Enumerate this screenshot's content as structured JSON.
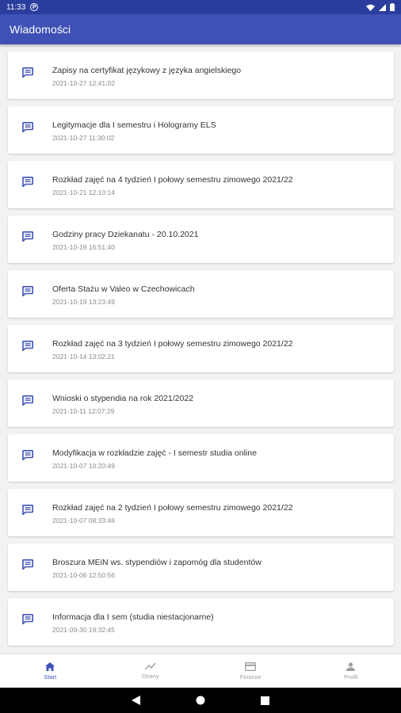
{
  "status_bar": {
    "time": "11:33"
  },
  "app_bar": {
    "title": "Wiadomości"
  },
  "messages": [
    {
      "title": "Zapisy na certyfikat językowy z języka angielskiego",
      "date": "2021-10-27 12:41:02"
    },
    {
      "title": "Legitymacje dla I semestru i Hologramy ELS",
      "date": "2021-10-27 11:30:02"
    },
    {
      "title": "Rozkład zajęć na 4 tydzień I połowy semestru zimowego 2021/22",
      "date": "2021-10-21 12:10:14"
    },
    {
      "title": "Godziny pracy Dziekanatu - 20.10.2021",
      "date": "2021-10-19 16:51:40"
    },
    {
      "title": "Oferta Stażu w Valeo w Czechowicach",
      "date": "2021-10-19 13:23:49"
    },
    {
      "title": "Rozkład zajęć na 3 tydzień I połowy semestru zimowego 2021/22",
      "date": "2021-10-14 13:02:21"
    },
    {
      "title": "Wnioski o stypendia na rok 2021/2022",
      "date": "2021-10-11 12:07:29"
    },
    {
      "title": "Modyfikacja w rozkładzie zajęć - I semestr studia online",
      "date": "2021-10-07 10:20:49"
    },
    {
      "title": "Rozkład zajęć na 2 tydzień I połowy semestru zimowego 2021/22",
      "date": "2021-10-07 08:33:46"
    },
    {
      "title": "Broszura MEiN ws. stypendiów i zapomóg dla studentów",
      "date": "2021-10-06 12:50:56"
    },
    {
      "title": "Informacja dla I sem (studia niestacjonarne)",
      "date": "2021-09-30 19:32:45"
    }
  ],
  "bottom_nav": [
    {
      "label": "Start",
      "icon": "home-icon",
      "active": true
    },
    {
      "label": "Oceny",
      "icon": "trending-icon",
      "active": false
    },
    {
      "label": "Finanse",
      "icon": "card-icon",
      "active": false
    },
    {
      "label": "Profil",
      "icon": "person-icon",
      "active": false
    }
  ],
  "colors": {
    "primary": "#3f51b5",
    "status_bar": "#2b3e9e",
    "background": "#f2f2f2"
  }
}
